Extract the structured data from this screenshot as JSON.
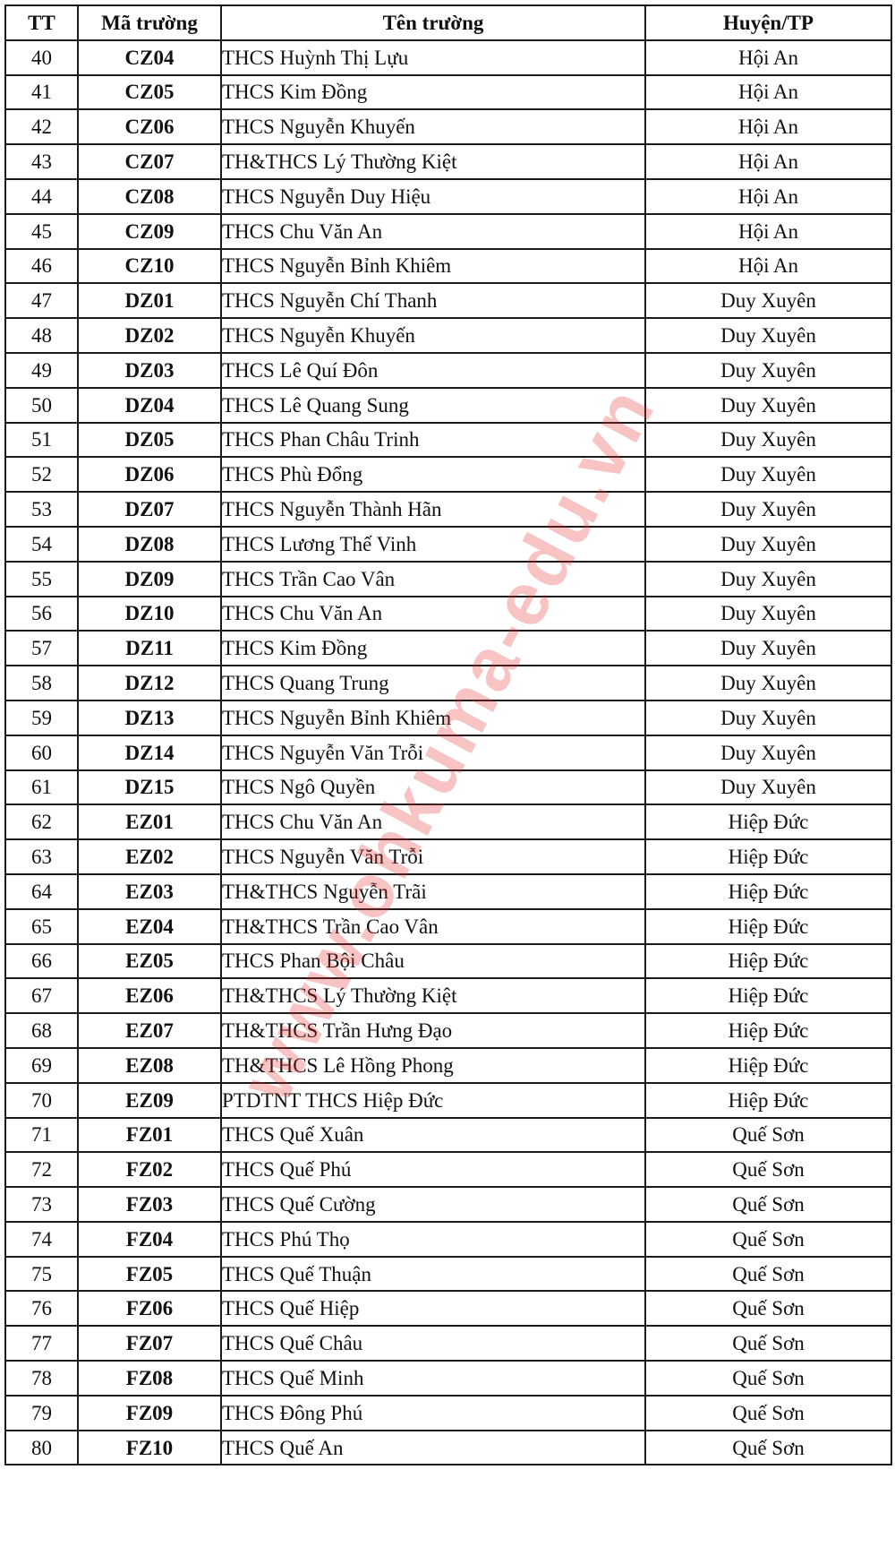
{
  "table": {
    "headers": {
      "tt": "TT",
      "code": "Mã trường",
      "name": "Tên trường",
      "district": "Huyện/TP"
    },
    "rows": [
      {
        "tt": "40",
        "code": "CZ04",
        "name": "THCS Huỳnh Thị Lựu",
        "district": "Hội An"
      },
      {
        "tt": "41",
        "code": "CZ05",
        "name": "THCS Kim Đồng",
        "district": "Hội An"
      },
      {
        "tt": "42",
        "code": "CZ06",
        "name": "THCS Nguyễn Khuyến",
        "district": "Hội An"
      },
      {
        "tt": "43",
        "code": "CZ07",
        "name": "TH&THCS Lý Thường Kiệt",
        "district": "Hội An"
      },
      {
        "tt": "44",
        "code": "CZ08",
        "name": "THCS Nguyễn Duy Hiệu",
        "district": "Hội An"
      },
      {
        "tt": "45",
        "code": "CZ09",
        "name": "THCS Chu Văn An",
        "district": "Hội An"
      },
      {
        "tt": "46",
        "code": "CZ10",
        "name": "THCS Nguyễn Bỉnh Khiêm",
        "district": "Hội An"
      },
      {
        "tt": "47",
        "code": "DZ01",
        "name": "THCS Nguyễn Chí Thanh",
        "district": "Duy Xuyên"
      },
      {
        "tt": "48",
        "code": "DZ02",
        "name": "THCS Nguyễn Khuyến",
        "district": "Duy Xuyên"
      },
      {
        "tt": "49",
        "code": "DZ03",
        "name": "THCS Lê Quí Đôn",
        "district": "Duy Xuyên"
      },
      {
        "tt": "50",
        "code": "DZ04",
        "name": "THCS Lê Quang Sung",
        "district": "Duy Xuyên"
      },
      {
        "tt": "51",
        "code": "DZ05",
        "name": "THCS Phan Châu Trinh",
        "district": "Duy Xuyên"
      },
      {
        "tt": "52",
        "code": "DZ06",
        "name": "THCS Phù Đổng",
        "district": "Duy Xuyên"
      },
      {
        "tt": "53",
        "code": "DZ07",
        "name": "THCS Nguyễn Thành Hãn",
        "district": "Duy Xuyên"
      },
      {
        "tt": "54",
        "code": "DZ08",
        "name": "THCS Lương Thế Vinh",
        "district": "Duy Xuyên"
      },
      {
        "tt": "55",
        "code": "DZ09",
        "name": "THCS Trần Cao Vân",
        "district": "Duy Xuyên"
      },
      {
        "tt": "56",
        "code": "DZ10",
        "name": "THCS Chu Văn An",
        "district": "Duy Xuyên"
      },
      {
        "tt": "57",
        "code": "DZ11",
        "name": "THCS Kim Đồng",
        "district": "Duy Xuyên"
      },
      {
        "tt": "58",
        "code": "DZ12",
        "name": "THCS Quang Trung",
        "district": "Duy Xuyên"
      },
      {
        "tt": "59",
        "code": "DZ13",
        "name": "THCS Nguyễn Bỉnh Khiêm",
        "district": "Duy Xuyên"
      },
      {
        "tt": "60",
        "code": "DZ14",
        "name": "THCS Nguyễn Văn Trỗi",
        "district": "Duy Xuyên"
      },
      {
        "tt": "61",
        "code": "DZ15",
        "name": "THCS Ngô Quyền",
        "district": "Duy Xuyên"
      },
      {
        "tt": "62",
        "code": "EZ01",
        "name": "THCS Chu Văn An",
        "district": "Hiệp Đức"
      },
      {
        "tt": "63",
        "code": "EZ02",
        "name": "THCS Nguyễn Văn Trỗi",
        "district": "Hiệp Đức"
      },
      {
        "tt": "64",
        "code": "EZ03",
        "name": "TH&THCS Nguyễn Trãi",
        "district": "Hiệp Đức"
      },
      {
        "tt": "65",
        "code": "EZ04",
        "name": "TH&THCS Trần Cao Vân",
        "district": "Hiệp Đức"
      },
      {
        "tt": "66",
        "code": "EZ05",
        "name": "THCS Phan Bội Châu",
        "district": "Hiệp Đức"
      },
      {
        "tt": "67",
        "code": "EZ06",
        "name": "TH&THCS Lý Thường Kiệt",
        "district": "Hiệp Đức"
      },
      {
        "tt": "68",
        "code": "EZ07",
        "name": "TH&THCS Trần Hưng Đạo",
        "district": "Hiệp Đức"
      },
      {
        "tt": "69",
        "code": "EZ08",
        "name": "TH&THCS Lê Hồng Phong",
        "district": "Hiệp Đức"
      },
      {
        "tt": "70",
        "code": "EZ09",
        "name": "PTDTNT THCS Hiệp Đức",
        "district": "Hiệp Đức"
      },
      {
        "tt": "71",
        "code": "FZ01",
        "name": "THCS Quế Xuân",
        "district": "Quế Sơn"
      },
      {
        "tt": "72",
        "code": "FZ02",
        "name": "THCS Quế Phú",
        "district": "Quế Sơn"
      },
      {
        "tt": "73",
        "code": "FZ03",
        "name": "THCS Quế Cường",
        "district": "Quế Sơn"
      },
      {
        "tt": "74",
        "code": "FZ04",
        "name": "THCS Phú Thọ",
        "district": "Quế Sơn"
      },
      {
        "tt": "75",
        "code": "FZ05",
        "name": "THCS Quế Thuận",
        "district": "Quế Sơn"
      },
      {
        "tt": "76",
        "code": "FZ06",
        "name": "THCS Quế Hiệp",
        "district": "Quế Sơn"
      },
      {
        "tt": "77",
        "code": "FZ07",
        "name": "THCS Quế Châu",
        "district": "Quế Sơn"
      },
      {
        "tt": "78",
        "code": "FZ08",
        "name": "THCS Quế Minh",
        "district": "Quế Sơn"
      },
      {
        "tt": "79",
        "code": "FZ09",
        "name": "THCS Đông Phú",
        "district": "Quế Sơn"
      },
      {
        "tt": "80",
        "code": "FZ10",
        "name": "THCS Quế An",
        "district": "Quế Sơn"
      }
    ]
  },
  "watermark": {
    "text": "www.ohkuma-edu.vn",
    "color": "#e62828"
  }
}
